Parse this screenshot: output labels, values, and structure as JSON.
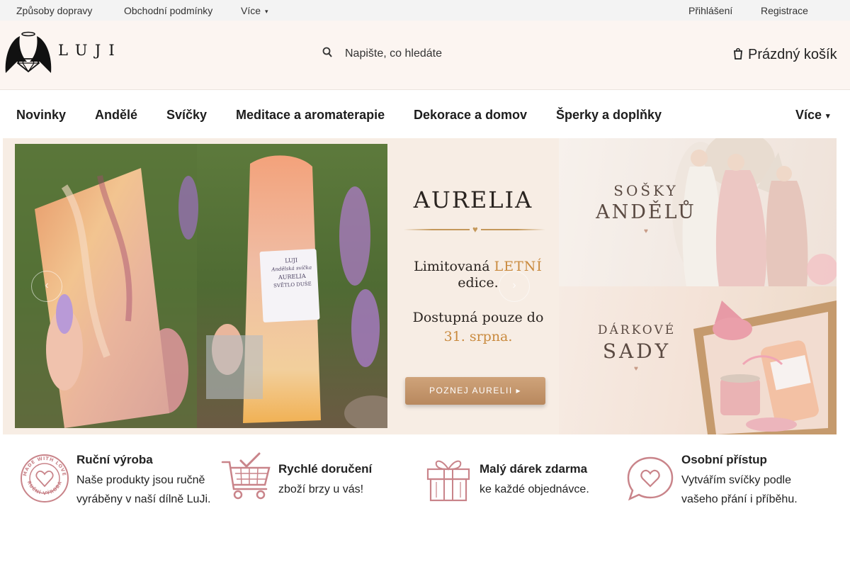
{
  "topbar": {
    "links": [
      "Způsoby dopravy",
      "Obchodní podmínky"
    ],
    "more_label": "Více",
    "login": "Přihlášení",
    "register": "Registrace"
  },
  "header": {
    "logo_text": "LUJI",
    "search_placeholder": "Napište, co hledáte",
    "cart_label": "Prázdný košík"
  },
  "nav": {
    "items": [
      "Novinky",
      "Andělé",
      "Svíčky",
      "Meditace a aromaterapie",
      "Dekorace a domov",
      "Šperky a doplňky"
    ],
    "more_label": "Více"
  },
  "slider": {
    "title": "AURELIA",
    "limited_pre": "Limitovaná ",
    "limited_gold": "LETNÍ",
    "limited_post": "edice.",
    "available_line": "Dostupná pouze do",
    "available_date": "31. srpna.",
    "cta": "POZNEJ AURELII ▸",
    "candle_label_brand": "LUJI",
    "candle_label_line1": "Andělská svíčka",
    "candle_label_line2": "AURELIA",
    "candle_label_line3": "SVĚTLO DUŠE"
  },
  "side_banners": [
    {
      "line1": "SOŠKY",
      "line2": "ANDĚLŮ"
    },
    {
      "line1": "DÁRKOVÉ",
      "line2": "SADY"
    }
  ],
  "benefits": [
    {
      "title": "Ruční výroba",
      "text1": "Naše produkty jsou ručně",
      "text2": "vyráběny v naší dílně LuJi.",
      "icon": "handmade-badge-icon",
      "badge_top": "MADE WITH LOVE",
      "badge_bottom": "RUČNÍ VÝROBA"
    },
    {
      "title": "Rychlé doručení",
      "text1": "zboží brzy u vás!",
      "text2": "",
      "icon": "shopping-cart-icon"
    },
    {
      "title": "Malý dárek zdarma",
      "text1": "ke každé objednávce.",
      "text2": "",
      "icon": "gift-icon"
    },
    {
      "title": "Osobní přístup",
      "text1": "Vytvářím svíčky podle",
      "text2": "vašeho přání i příběhu.",
      "icon": "heart-chat-icon"
    }
  ],
  "colors": {
    "accent": "#c9848a",
    "gold": "#c98a3e",
    "header_bg": "#fcf5f1"
  }
}
